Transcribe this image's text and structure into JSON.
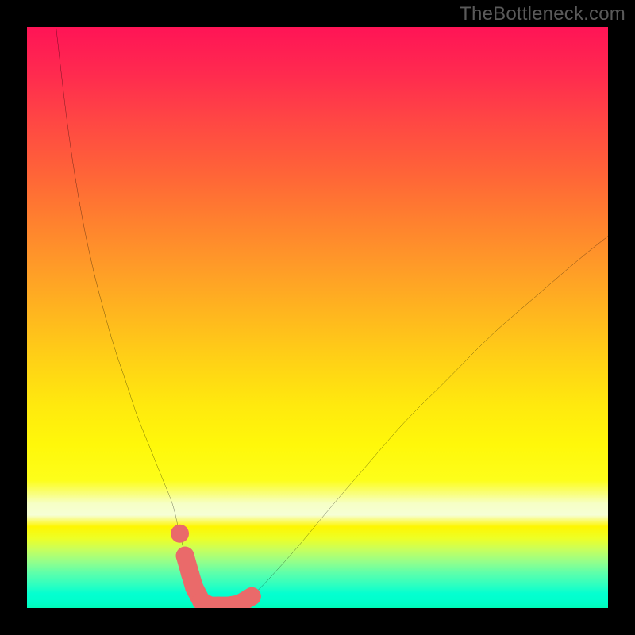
{
  "watermark": "TheBottleneck.com",
  "chart_data": {
    "type": "line",
    "xlim": [
      0,
      100
    ],
    "ylim": [
      0,
      100
    ],
    "curve_left": {
      "x": [
        5,
        7,
        9,
        11,
        13,
        15,
        17,
        19,
        21,
        23,
        25,
        26,
        27,
        28,
        29,
        30,
        31,
        32
      ],
      "y": [
        100,
        83,
        70,
        60,
        52,
        45,
        39,
        33,
        28,
        23,
        18,
        14,
        10,
        7,
        4.5,
        2.5,
        1,
        0.3
      ]
    },
    "curve_right": {
      "x": [
        36,
        38,
        40,
        43,
        47,
        52,
        58,
        65,
        72,
        80,
        88,
        95,
        100
      ],
      "y": [
        0.3,
        1.5,
        3.3,
        6.5,
        11,
        17,
        24,
        32,
        39,
        47,
        54,
        60,
        64
      ]
    },
    "tick_markers": {
      "x": [
        26.3,
        27.2,
        28.1,
        28.8,
        30.0,
        31.5,
        33.0,
        34.7,
        36.5,
        38.7
      ],
      "y": [
        12.8,
        9.0,
        5.8,
        3.5,
        1.2,
        0.4,
        0.4,
        0.4,
        0.7,
        2.0
      ]
    },
    "marker_color": "#ea6a6a",
    "curve_color": "#000000",
    "curve_width": 2.0,
    "marker_radius": 11.5
  }
}
